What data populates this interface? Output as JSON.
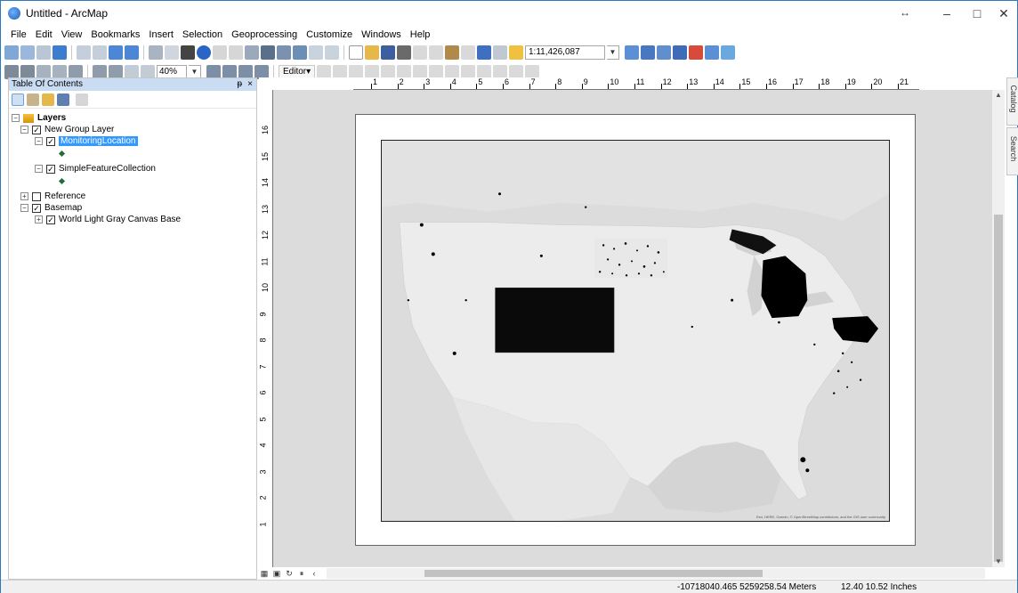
{
  "window": {
    "title": "Untitled - ArcMap",
    "resize_hint": "↔",
    "minimize_icon": "minimize-icon",
    "maximize_icon": "maximize-icon",
    "close_icon": "close-icon"
  },
  "menu": [
    "File",
    "Edit",
    "View",
    "Bookmarks",
    "Insert",
    "Selection",
    "Geoprocessing",
    "Customize",
    "Windows",
    "Help"
  ],
  "toolbar": {
    "scale_value": "1:11,426,087",
    "zoom_percent": "40%",
    "editor_label": "Editor▾"
  },
  "toc": {
    "title": "Table Of Contents",
    "pin": "ᵽ",
    "close": "×",
    "tree": {
      "layers": "Layers",
      "group": "New Group Layer",
      "monitoring": "MonitoringLocation",
      "simple": "SimpleFeatureCollection",
      "reference": "Reference",
      "basemap": "Basemap",
      "world": "World Light Gray Canvas Base"
    }
  },
  "ruler": {
    "h_labels": [
      "1",
      "2",
      "3",
      "4",
      "5",
      "6",
      "7",
      "8",
      "9",
      "10",
      "11",
      "12",
      "13",
      "14",
      "15",
      "16",
      "17",
      "18",
      "19",
      "20",
      "21"
    ],
    "v_labels": [
      "16",
      "15",
      "14",
      "13",
      "12",
      "11",
      "10",
      "9",
      "8",
      "7",
      "6",
      "5",
      "4",
      "3",
      "2",
      "1"
    ]
  },
  "side_tabs": [
    "Catalog",
    "Search"
  ],
  "map": {
    "credits": "Esri, HERE, Garmin, © OpenStreetMap contributors, and the GIS user community"
  },
  "status": {
    "coords": "-10718040.465  5259258.54 Meters",
    "page_units": "12.40  10.52 Inches"
  }
}
